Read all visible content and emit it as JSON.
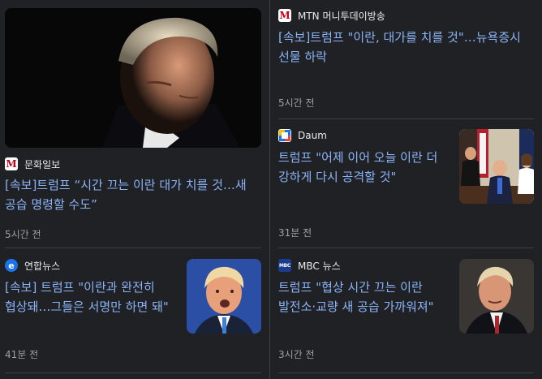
{
  "cards": [
    {
      "source": "문화일보",
      "title": "[속보]트럼프 “시간 끄는 이란 대가 치를 것…새 공습 명령할 수도”",
      "time": "5시간 전"
    },
    {
      "source": "MTN 머니투데이방송",
      "title": "[속보]트럼프 \"이란, 대가를 치를 것\"…뉴욕증시 선물 하락",
      "time": "5시간 전"
    },
    {
      "source": "Daum",
      "title": "트럼프 \"어제 이어 오늘 이란 더 강하게 다시 공격할 것\"",
      "time": "31분 전"
    },
    {
      "source": "연합뉴스",
      "title": "[속보] 트럼프 \"이란과 완전히 협상돼…그들은 서명만 하면 돼\"",
      "time": "41분 전"
    },
    {
      "source": "MBC 뉴스",
      "title": "트럼프 \"협상 시간 끄는 이란 발전소·교량 새 공습 가까워져\"",
      "time": "3시간 전"
    }
  ],
  "logos": {
    "munhwa": "M",
    "mtn": "M",
    "yonhap": "e",
    "mbc": "MBC"
  },
  "colors": {
    "background": "#202124",
    "link": "#8ab4f8",
    "meta": "#9aa0a6",
    "divider": "#3c4043"
  }
}
